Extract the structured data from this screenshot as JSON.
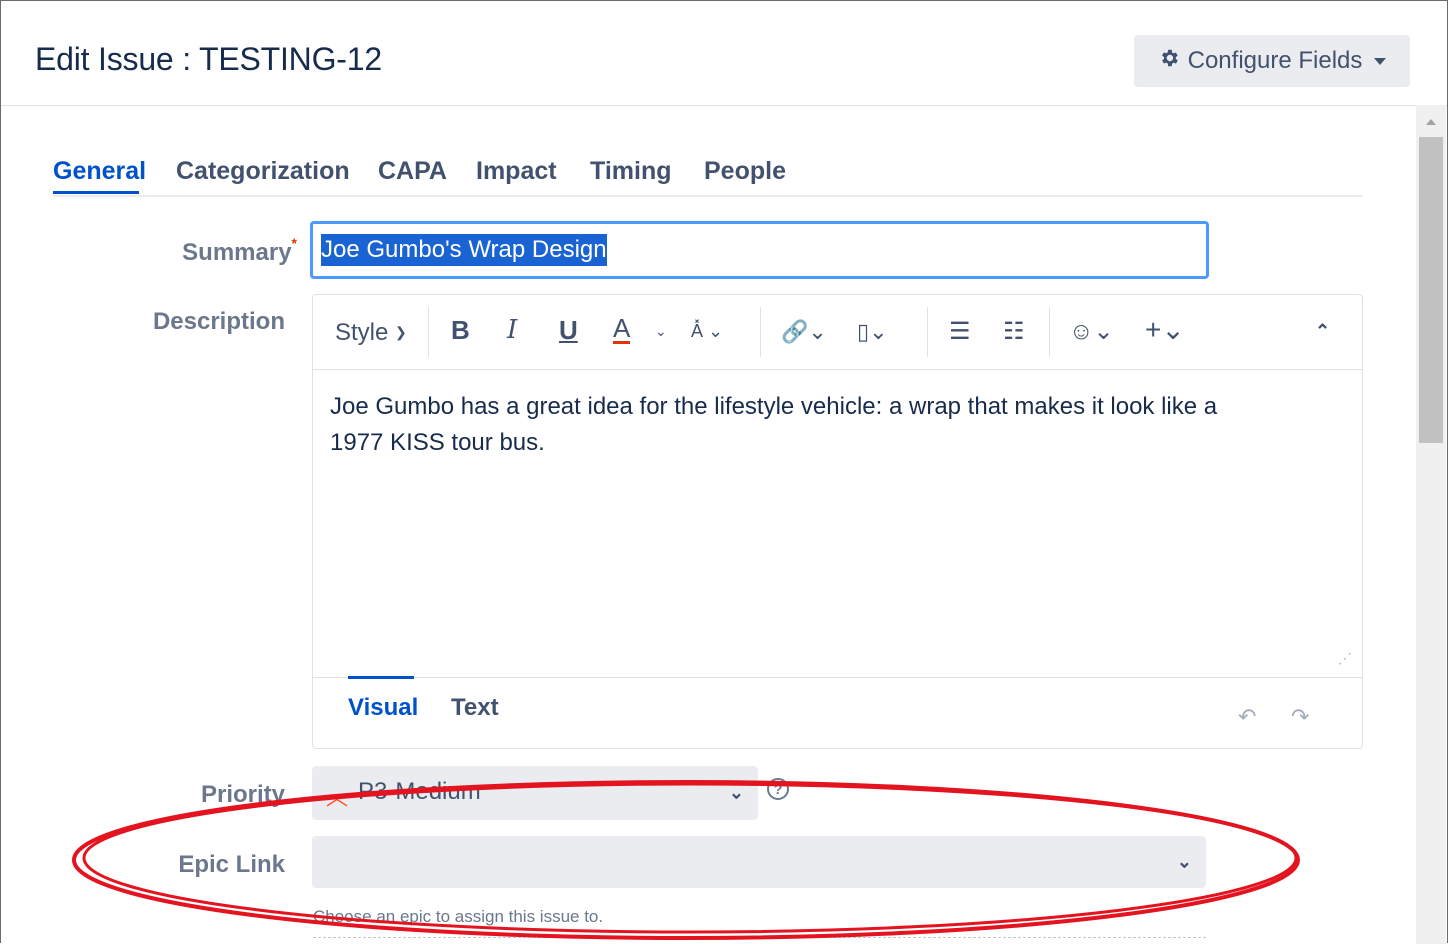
{
  "dialog": {
    "title": "Edit Issue : TESTING-12",
    "configure_label": "Configure Fields"
  },
  "tabs": [
    {
      "label": "General",
      "active": true
    },
    {
      "label": "Categorization"
    },
    {
      "label": "CAPA"
    },
    {
      "label": "Impact"
    },
    {
      "label": "Timing"
    },
    {
      "label": "People"
    }
  ],
  "fields": {
    "summary_label": "Summary",
    "summary_required": "*",
    "summary_value": "Joe Gumbo's Wrap Design",
    "description_label": "Description",
    "description_text": "Joe Gumbo has a great idea for the lifestyle vehicle: a wrap that makes it look like a 1977 KISS tour bus.",
    "priority_label": "Priority",
    "priority_value": "P3-Medium",
    "epic_label": "Epic Link",
    "epic_value": "",
    "epic_hint": "Choose an epic to assign this issue to."
  },
  "editor": {
    "style_label": "Style",
    "bold": "B",
    "italic": "I",
    "underline": "U",
    "color": "A",
    "visual_tab": "Visual",
    "text_tab": "Text"
  },
  "icons": {
    "configure": "gear-icon",
    "priority": "chevron-up-icon",
    "help": "help-icon"
  },
  "colors": {
    "accent": "#0052cc",
    "focus": "#4c9aff",
    "annotation": "#e3141f",
    "priority": "#ff5630"
  }
}
